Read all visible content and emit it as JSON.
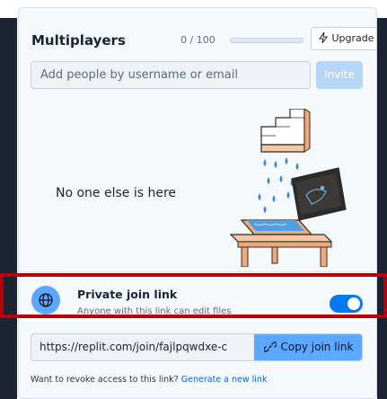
{
  "header": {
    "title": "Multiplayers",
    "count": "0 / 100",
    "progress_fraction": 0,
    "upgrade_label": "Upgrade",
    "upgrade_icon": "lightning-icon"
  },
  "invite": {
    "placeholder": "Add people by username or email",
    "button_label": "Invite"
  },
  "empty_state": {
    "text": "No one else is here",
    "illustration": "flooded-laptop-illustration"
  },
  "private_link": {
    "icon": "globe-icon",
    "title": "Private join link",
    "subtitle": "Anyone with this link can edit files",
    "toggle_on": true
  },
  "join_link": {
    "url": "https://replit.com/join/fajlpqwdxe-c",
    "copy_label": "Copy join link",
    "copy_icon": "link-icon"
  },
  "revoke": {
    "text": "Want to revoke access to this link?",
    "link_label": "Generate a new link"
  },
  "colors": {
    "accent": "#0079f2",
    "highlight": "#b5000c",
    "copy_button": "#5ca8ff"
  }
}
